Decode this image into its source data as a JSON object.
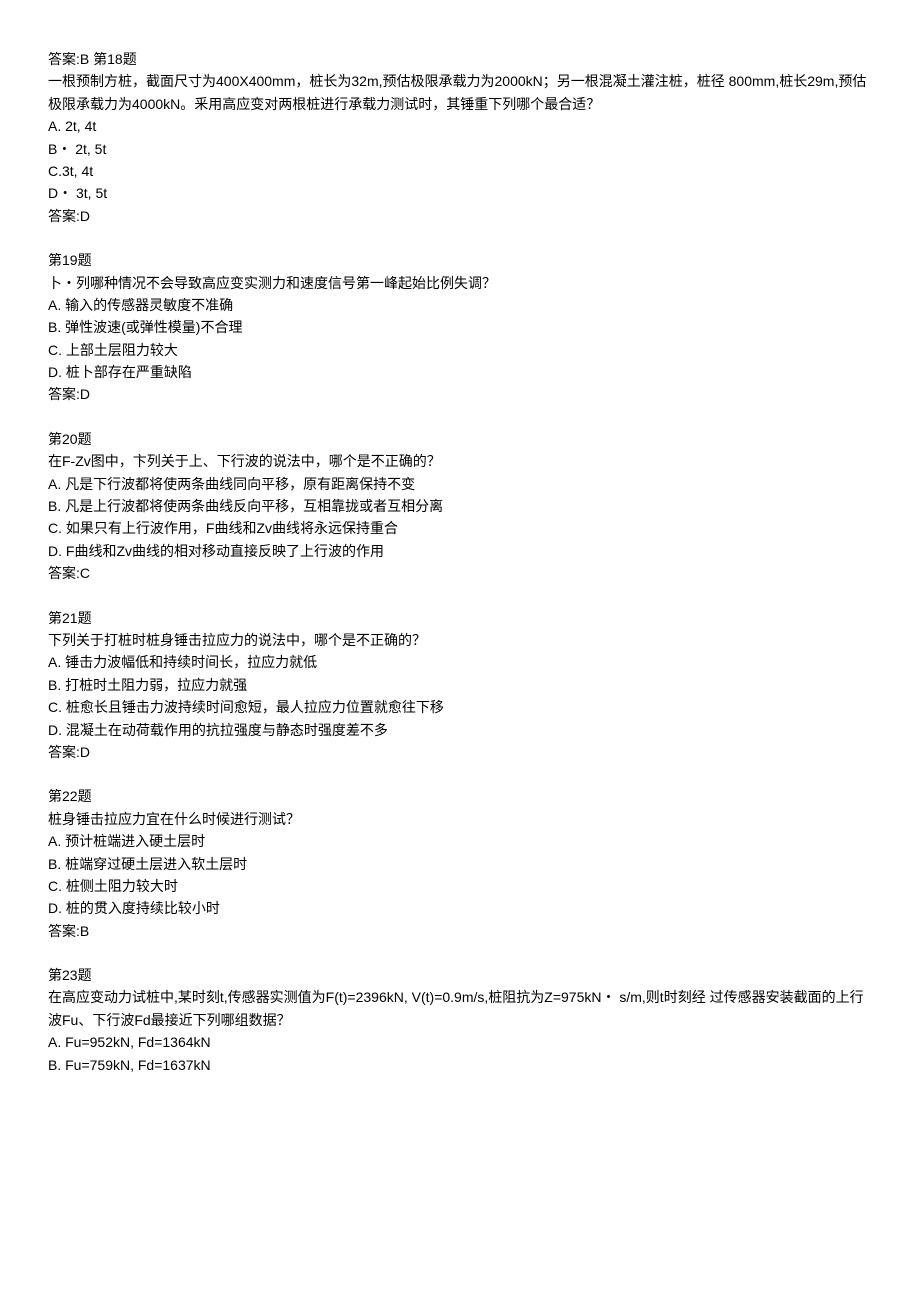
{
  "top_answer": "答案:B 第18题",
  "q18": {
    "stem": "一根预制方桩，截面尺寸为400X400mm，桩长为32m,预估极限承载力为2000kN；另一根混凝土灌注桩，桩径 800mm,桩长29m,预估极限承载力为4000kN。釆用高应变对两根桩进行承载力测试时，其锤重下列哪个最合适？",
    "A": "A.    2t, 4t",
    "B": "B・ 2t, 5t",
    "C": "C.3t, 4t",
    "D": "D・ 3t, 5t",
    "ans": "答案:D"
  },
  "q19": {
    "title": "第19题",
    "stem": "卜・列哪种情况不会导致高应变实测力和速度信号第一峰起始比例失调？",
    "A": "A.  输入的传感器灵敏度不准确",
    "B": "B.  弹性波速(或弹性模量)不合理",
    "C": "C.  上部土层阻力较大",
    "D": "D.  桩卜部存在严重缺陷",
    "ans": "答案:D"
  },
  "q20": {
    "title": "第20题",
    "stem": "在F-Zv图中，卞列关于上、下行波的说法中，哪个是不正确的？",
    "A": "A.  凡是下行波都将使两条曲线同向平移，原有距离保持不变",
    "B": "B.  凡是上行波都将使两条曲线反向平移，互相靠拢或者互相分离",
    "C": "C.  如果只有上行波作用，F曲线和Zv曲线将永远保持重合",
    "D": "D.  F曲线和Zv曲线的相对移动直接反映了上行波的作用",
    "ans": "答案:C"
  },
  "q21": {
    "title": "第21题",
    "stem": "下列关于打桩时桩身锤击拉应力的说法中，哪个是不正确的？",
    "A": "A.  锤击力波幅低和持续时间长，拉应力就低",
    "B": "B.  打桩时土阻力弱，拉应力就强",
    "C": "C.  桩愈长且锤击力波持续时间愈短，最人拉应力位置就愈往下移",
    "D": "D.  混凝土在动荷载作用的抗拉强度与静态时强度差不多",
    "ans": "答案:D"
  },
  "q22": {
    "title": "第22题",
    "stem": "桩身锤击拉应力宜在什么时候进行测试？",
    "A": "A.  预计桩端进入硬土层时",
    "B": "B.  桩端穿过硬土层进入软土层时",
    "C": "C.  桩侧土阻力较大时",
    "D": "D.  桩的贯入度持续比较小时",
    "ans": "答案:B"
  },
  "q23": {
    "title": "第23题",
    "stem": "在高应变动力试桩中,某时刻t,传感器实测值为F(t)=2396kN, V(t)=0.9m/s,桩阻抗为Z=975kN・ s/m,则t时刻经  过传感器安装截面的上行波Fu、下行波Fd最接近下列哪组数据？",
    "A": "A.  Fu=952kN, Fd=1364kN",
    "B": "B.  Fu=759kN, Fd=1637kN"
  }
}
